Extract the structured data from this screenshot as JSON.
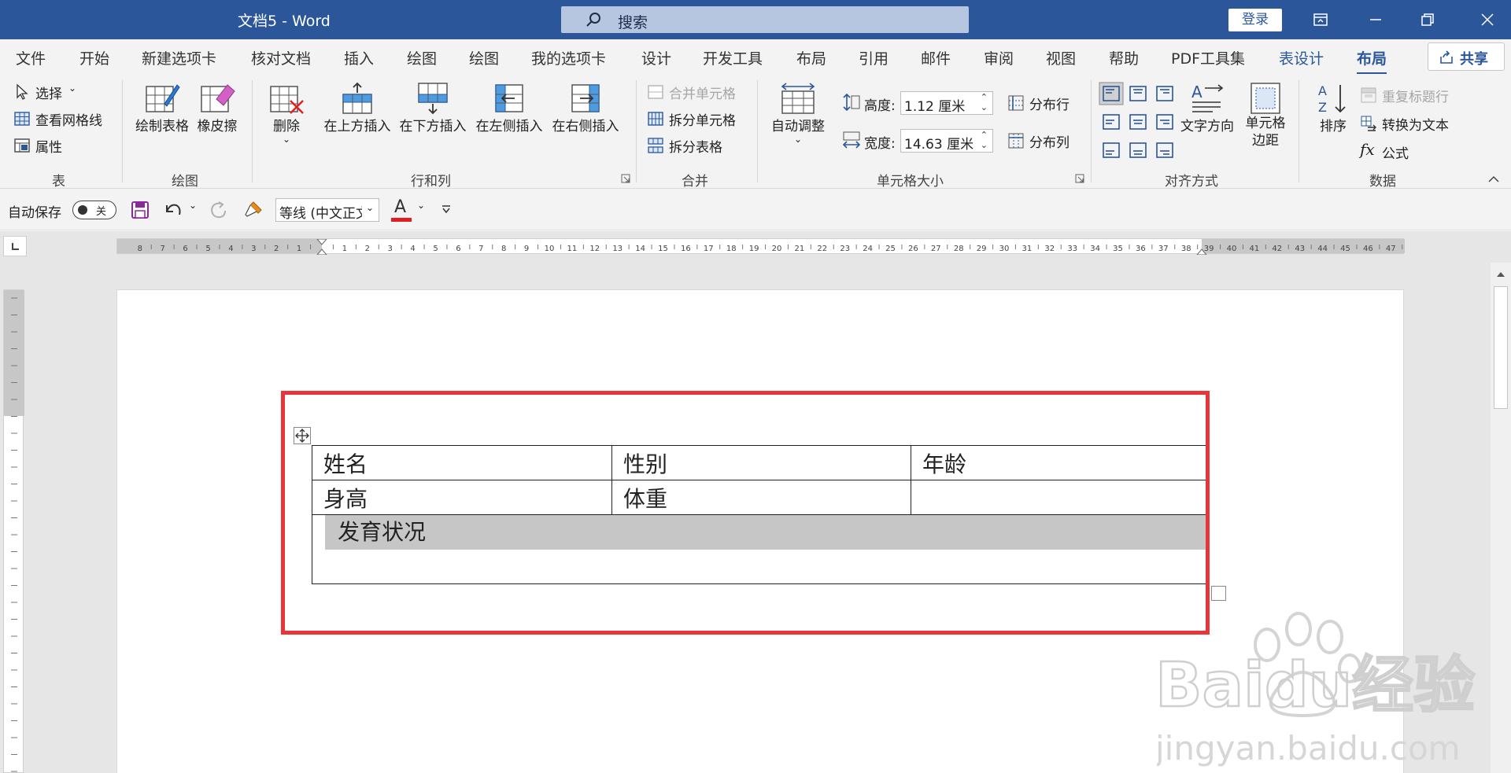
{
  "titlebar": {
    "doc_title": "文档5  -  Word",
    "search_placeholder": "搜索",
    "login_label": "登录"
  },
  "tabs": [
    {
      "label": "文件"
    },
    {
      "label": "开始"
    },
    {
      "label": "新建选项卡"
    },
    {
      "label": "核对文档"
    },
    {
      "label": "插入"
    },
    {
      "label": "绘图"
    },
    {
      "label": "绘图"
    },
    {
      "label": "我的选项卡"
    },
    {
      "label": "设计"
    },
    {
      "label": "开发工具"
    },
    {
      "label": "布局"
    },
    {
      "label": "引用"
    },
    {
      "label": "邮件"
    },
    {
      "label": "审阅"
    },
    {
      "label": "视图"
    },
    {
      "label": "帮助"
    },
    {
      "label": "PDF工具集"
    },
    {
      "label": "表设计"
    },
    {
      "label": "布局"
    }
  ],
  "share_label": "共享",
  "ribbon": {
    "table_group": {
      "label": "表",
      "select": "选择",
      "gridlines": "查看网格线",
      "properties": "属性"
    },
    "draw_group": {
      "label": "绘图",
      "draw_table": "绘制表格",
      "eraser": "橡皮擦"
    },
    "rows_cols_group": {
      "label": "行和列",
      "delete": "删除",
      "insert_above": "在上方插入",
      "insert_below": "在下方插入",
      "insert_left": "在左侧插入",
      "insert_right": "在右侧插入"
    },
    "merge_group": {
      "label": "合并",
      "merge_cells": "合并单元格",
      "split_cells": "拆分单元格",
      "split_table": "拆分表格"
    },
    "cell_size_group": {
      "label": "单元格大小",
      "autofit": "自动调整",
      "height_label": "高度:",
      "height_value": "1.12 厘米",
      "width_label": "宽度:",
      "width_value": "14.63 厘米",
      "distribute_rows": "分布行",
      "distribute_cols": "分布列"
    },
    "alignment_group": {
      "label": "对齐方式",
      "text_direction": "文字方向",
      "cell_margins_1": "单元格",
      "cell_margins_2": "边距"
    },
    "data_group": {
      "label": "数据",
      "sort": "排序",
      "repeat_header": "重复标题行",
      "convert_text": "转换为文本",
      "formula": "公式"
    }
  },
  "qat": {
    "autosave_label": "自动保存",
    "autosave_state": "关",
    "font_name": "等线 (中文正文)"
  },
  "table": {
    "rows": [
      [
        "姓名",
        "性别",
        "年龄"
      ],
      [
        "身高",
        "体重",
        ""
      ]
    ],
    "merged_row": "发育状况"
  },
  "watermark": {
    "brand": "Baidu经验",
    "url": "jingyan.baidu.com"
  },
  "colors": {
    "accent": "#2b579a",
    "highlight": "#e8353a",
    "selection": "#c6c6c6"
  }
}
